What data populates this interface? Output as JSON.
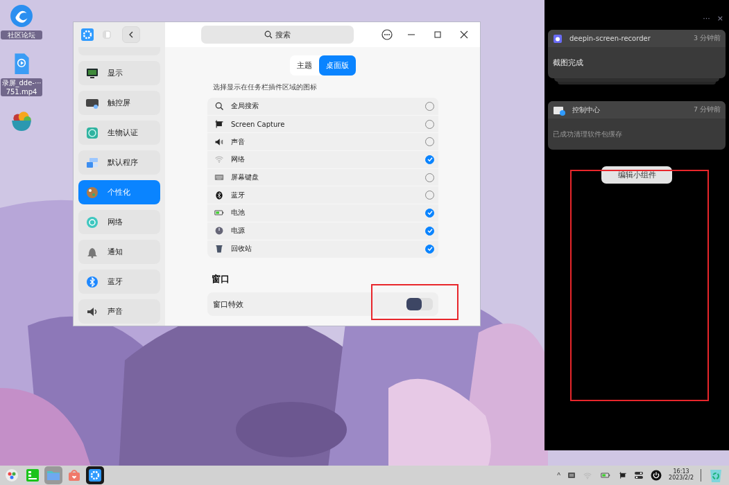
{
  "desktop_icons": [
    {
      "kind": "shortcut",
      "label": "社区论坛"
    },
    {
      "kind": "video",
      "label": "录屏_dde-···751.mp4"
    },
    {
      "kind": "app"
    }
  ],
  "window": {
    "search": {
      "placeholder": "搜索"
    },
    "sidebar": {
      "items": [
        {
          "label": "显示",
          "selected": false
        },
        {
          "label": "触控屏",
          "selected": false
        },
        {
          "label": "生物认证",
          "selected": false
        },
        {
          "label": "默认程序",
          "selected": false
        },
        {
          "label": "个性化",
          "selected": true
        },
        {
          "label": "网络",
          "selected": false
        },
        {
          "label": "通知",
          "selected": false
        },
        {
          "label": "蓝牙",
          "selected": false
        },
        {
          "label": "声音",
          "selected": false
        }
      ]
    },
    "tabs": [
      {
        "label": "主题",
        "selected": false
      },
      {
        "label": "桌面版",
        "selected": true
      }
    ],
    "plugins_caption": "选择显示在任务栏插件区域的图标",
    "plugins": [
      {
        "label": "全局搜索",
        "checked": false
      },
      {
        "label": "Screen Capture",
        "checked": false
      },
      {
        "label": "声音",
        "checked": false
      },
      {
        "label": "网络",
        "checked": true
      },
      {
        "label": "屏幕键盘",
        "checked": false
      },
      {
        "label": "蓝牙",
        "checked": false
      },
      {
        "label": "电池",
        "checked": true
      },
      {
        "label": "电源",
        "checked": true
      },
      {
        "label": "回收站",
        "checked": true
      }
    ],
    "section_title": "窗口",
    "settings": [
      {
        "label": "窗口特效",
        "on": false
      }
    ]
  },
  "notification_center": {
    "more": "···",
    "close": "×",
    "notifications": [
      {
        "app": "deepin-screen-recorder",
        "time": "3 分钟前",
        "body": "截图完成",
        "stacked": true
      },
      {
        "app": "控制中心",
        "time": "7 分钟前",
        "body": "已成功清理软件包缓存",
        "stacked": false
      }
    ],
    "edit_button": "编辑小组件"
  },
  "taskbar": {
    "apps": [
      {
        "selected": false
      },
      {
        "selected": false
      },
      {
        "selected": true
      },
      {
        "selected": false
      },
      {
        "selected": true
      }
    ],
    "tray_caret": "^",
    "time": "16:13",
    "date": "2023/2/2"
  }
}
